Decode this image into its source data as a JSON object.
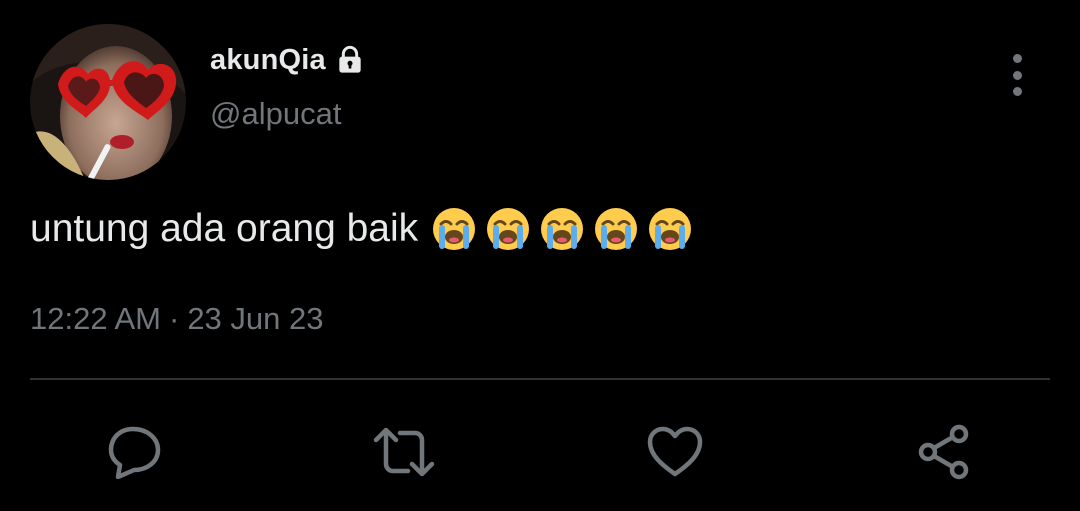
{
  "author": {
    "display_name": "akunQia",
    "handle": "@alpucat",
    "protected_icon": "lock-icon",
    "avatar_icon": "profile-photo"
  },
  "tweet": {
    "text": "untung ada orang baik",
    "emoji": [
      "😭",
      "😭",
      "😭",
      "😭",
      "😭"
    ],
    "time": "12:22 AM",
    "separator": "·",
    "date": "23 Jun 23"
  },
  "actions": {
    "more_icon": "more-vertical-icon",
    "reply_icon": "reply-icon",
    "retweet_icon": "retweet-icon",
    "like_icon": "heart-icon",
    "share_icon": "share-icon"
  },
  "colors": {
    "background": "#000000",
    "primary_text": "#e7e9ea",
    "secondary_text": "#71767b",
    "divider": "#2f3336"
  }
}
